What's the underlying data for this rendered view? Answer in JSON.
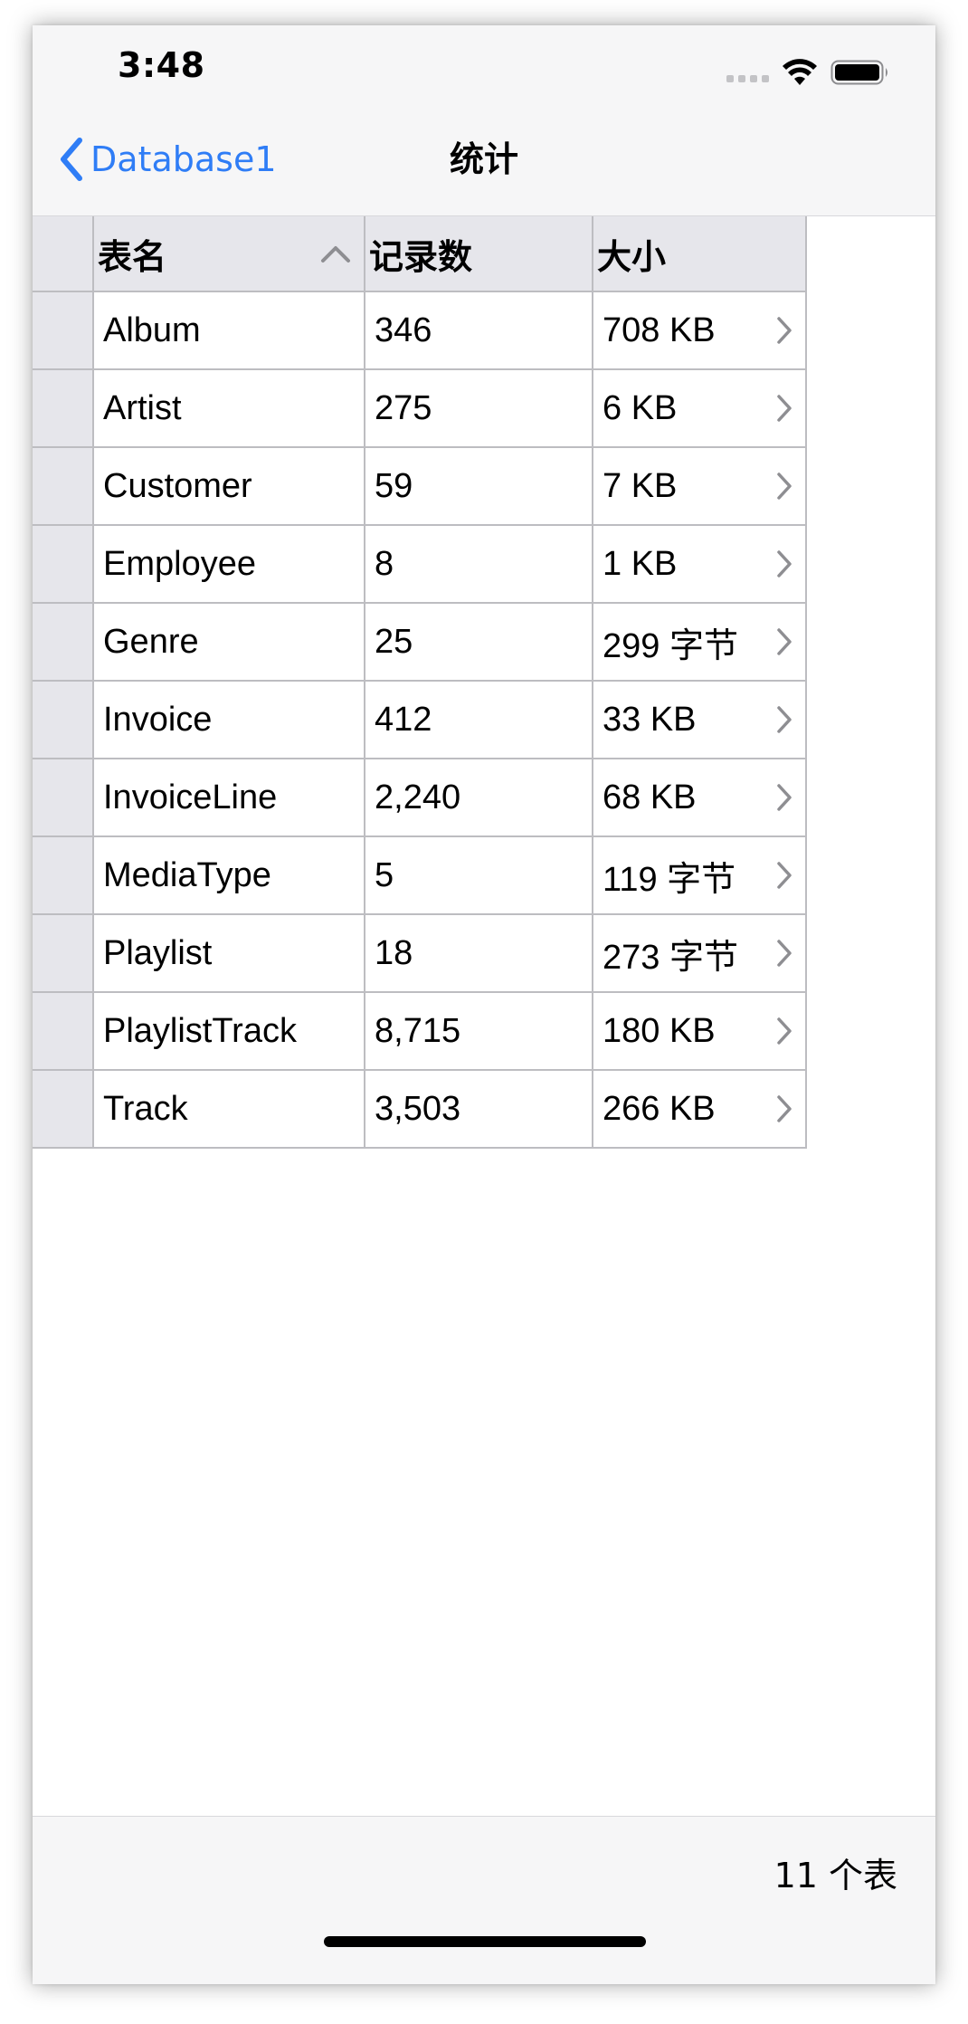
{
  "status_bar": {
    "time": "3:48",
    "icons": [
      "signal-dots-icon",
      "wifi-icon",
      "battery-icon"
    ]
  },
  "nav": {
    "back_label": "Database1",
    "title": "统计"
  },
  "table": {
    "columns": [
      "表名",
      "记录数",
      "大小"
    ],
    "sort_column": "表名",
    "sort_direction": "ascending",
    "rows": [
      {
        "name": "Album",
        "count": "346",
        "size": "708 KB"
      },
      {
        "name": "Artist",
        "count": "275",
        "size": "6 KB"
      },
      {
        "name": "Customer",
        "count": "59",
        "size": "7 KB"
      },
      {
        "name": "Employee",
        "count": "8",
        "size": "1 KB"
      },
      {
        "name": "Genre",
        "count": "25",
        "size": "299 字节"
      },
      {
        "name": "Invoice",
        "count": "412",
        "size": "33 KB"
      },
      {
        "name": "InvoiceLine",
        "count": "2,240",
        "size": "68 KB"
      },
      {
        "name": "MediaType",
        "count": "5",
        "size": "119 字节"
      },
      {
        "name": "Playlist",
        "count": "18",
        "size": "273 字节"
      },
      {
        "name": "PlaylistTrack",
        "count": "8,715",
        "size": "180 KB"
      },
      {
        "name": "Track",
        "count": "3,503",
        "size": "266 KB"
      }
    ]
  },
  "footer": {
    "count_label": "11 个表"
  },
  "colors": {
    "accent": "#2f7df6",
    "header_bg": "#e6e6eb",
    "grid": "#bdbdc1",
    "bar_bg": "#f6f6f7"
  }
}
